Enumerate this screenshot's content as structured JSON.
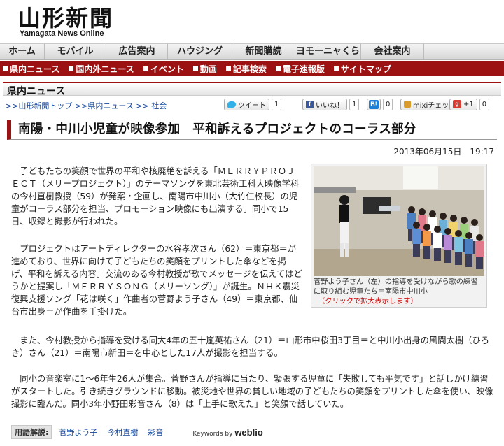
{
  "site": {
    "logo_text": "山形新聞",
    "logo_sub": "Yamagata News Online"
  },
  "nav": {
    "items": [
      "ホーム",
      "モバイル",
      "広告案内",
      "ハウジング",
      "新聞購読",
      "ヨモーニャくらぶ",
      "会社案内"
    ]
  },
  "subnav": {
    "items": [
      "県内ニュース",
      "国内外ニュース",
      "イベント",
      "動画",
      "記事検索",
      "電子速報版",
      "サイトマップ"
    ]
  },
  "section": {
    "title": "県内ニュース"
  },
  "breadcrumb": {
    "items": [
      ">>山形新聞トップ",
      ">>県内ニュース",
      ">> 社会"
    ]
  },
  "social": {
    "tweet_label": "ツイート",
    "tweet_count": "1",
    "like_label": "いいね！",
    "like_count": "1",
    "hatena_label": "B!",
    "hatena_count": "0",
    "mixi_label": "mixiチェック",
    "gplus_label": "+1",
    "gplus_count": "0"
  },
  "article": {
    "headline": "南陽・中川小児童が映像参加　平和訴えるプロジェクトのコーラス部分",
    "date": "2013年06月15日　19:17",
    "paragraphs": [
      "　子どもたちの笑顔で世界の平和や核廃絶を訴える「ＭＥＲＲＹＰＲＯＪＥＣＴ（メリープロジェクト）」のテーマソングを東北芸術工科大映像学科の今村直樹教授（59）が発案・企画し、南陽市中川小（大竹仁校長）の児童がコーラス部分を担当、プロモーション映像にも出演する。同小で15日、収録と撮影が行われた。",
      "　プロジェクトはアートディレクターの水谷孝次さん（62）＝東京都＝が進めており、世界に向けて子どもたちの笑顔をプリントした傘などを掲げ、平和を訴える内容。交流のある今村教授が歌でメッセージを伝えてはどうかと提案し「ＭＥＲＲＹＳＯＮＧ（メリーソング）」が誕生。ＮＨＫ震災復興支援ソング「花は咲く」作曲者の菅野よう子さん（49）＝東京都、仙台市出身＝が作曲を手掛けた。",
      "　また、今村教授から指導を受ける同大4年の五十嵐英祐さん（21）＝山形市中桜田3丁目＝と中川小出身の風間太樹（ひろき）さん（21）＝南陽市新田＝を中心とした17人が撮影を担当する。",
      "　同小の音楽室に1～6年生26人が集合。菅野さんが指導に当たり、緊張する児童に「失敗しても平気です」と話しかけ練習がスタートした。引き続きグラウンドに移動。被災地や世界の貧しい地域の子どもたちの笑顔をプリントした傘を使い、映像撮影に臨んだ。同小3年小野田彩音さん（8）は「上手に歌えた」と笑顔で話していた。"
    ],
    "photo_caption": "菅野よう子さん（左）の指導を受けながら歌の練習に取り組む児童たち＝南陽市中川小",
    "photo_link": "（クリックで拡大表示します）"
  },
  "keywords": {
    "label": "用語解説:",
    "items": [
      "菅野よう子",
      "今村直樹",
      "彩音"
    ],
    "by_text": "Keywords by",
    "brand": "weblio"
  },
  "colors": {
    "brand_red": "#9c1212",
    "link_blue": "#114499"
  }
}
